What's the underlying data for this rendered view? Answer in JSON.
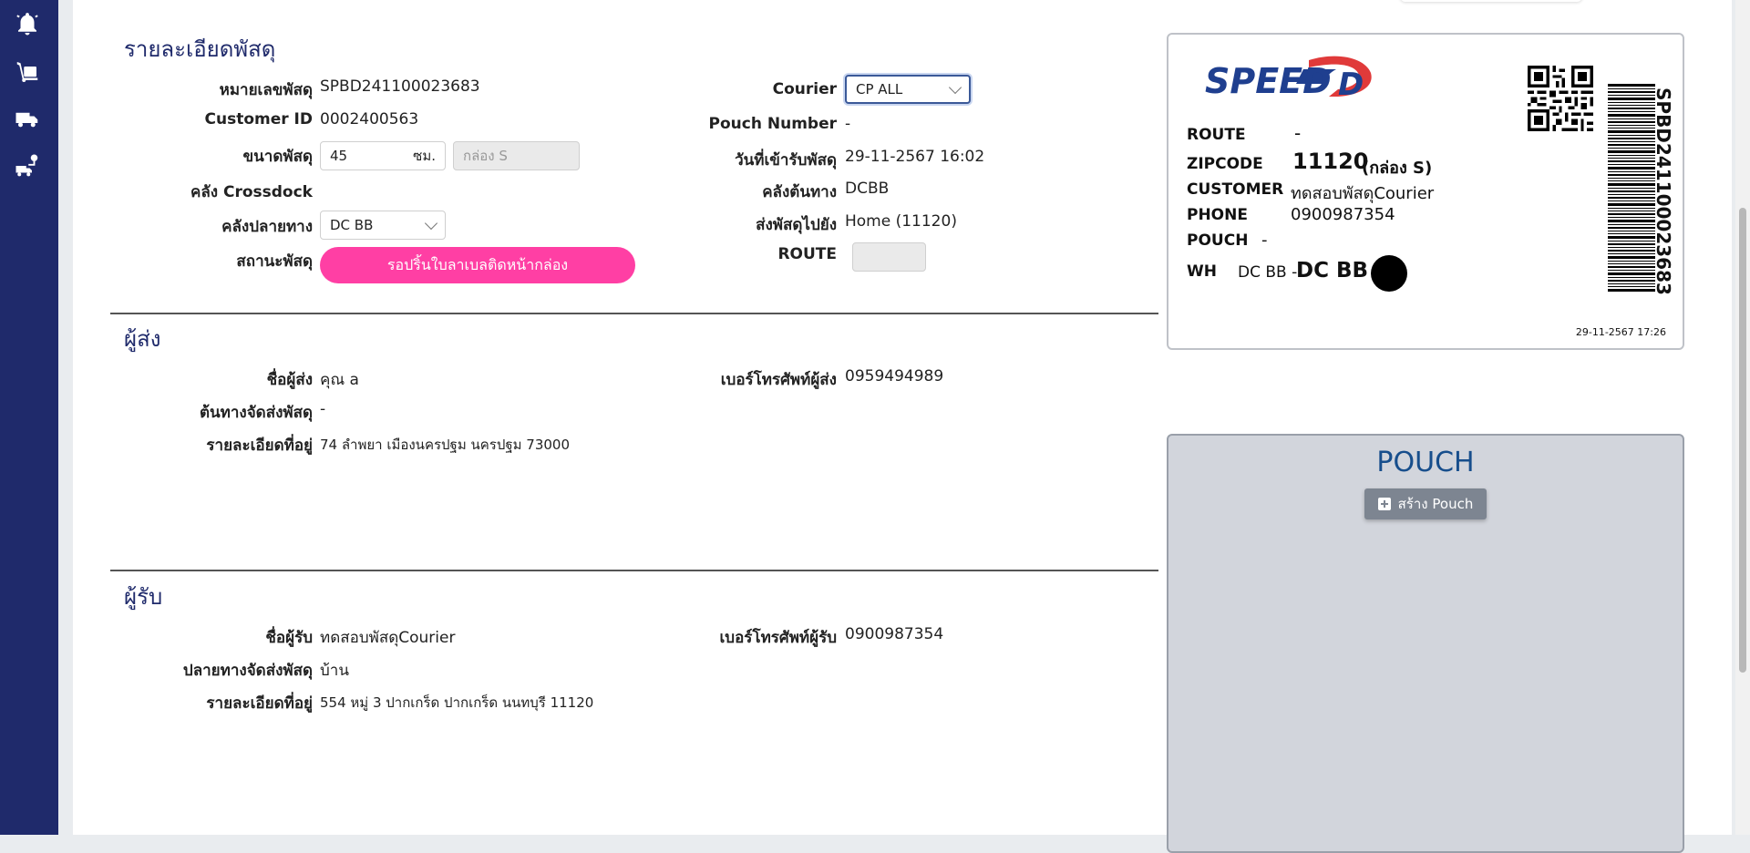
{
  "sidebar": {
    "icons": [
      "bell-icon",
      "box-dolly-icon",
      "truck-icon",
      "route-truck-icon"
    ]
  },
  "parcel": {
    "title": "รายละเอียดพัสดุ",
    "tracking_label": "หมายเลขพัสดุ",
    "tracking_value": "SPBD241100023683",
    "customer_id_label": "Customer ID",
    "customer_id_value": "0002400563",
    "size_label": "ขนาดพัสดุ",
    "size_value": "45",
    "size_unit": "ซม.",
    "box_placeholder": "กล่อง S",
    "crossdock_label": "คลัง Crossdock",
    "dest_wh_label": "คลังปลายทาง",
    "dest_wh_value": "DC BB",
    "status_label": "สถานะพัสดุ",
    "status_value": "รอปริ้นใบลาเบลติดหน้ากล่อง",
    "courier_label": "Courier",
    "courier_value": "CP ALL",
    "pouch_number_label": "Pouch Number",
    "pouch_number_value": "-",
    "received_label": "วันที่เข้ารับพัสดุ",
    "received_value": "29-11-2567 16:02",
    "origin_wh_label": "คลังต้นทาง",
    "origin_wh_value": "DCBB",
    "send_to_label": "ส่งพัสดุไปยัง",
    "send_to_value": "Home (11120)",
    "route_label": "ROUTE",
    "route_value": ""
  },
  "sender": {
    "title": "ผู้ส่ง",
    "name_label": "ชื่อผู้ส่ง",
    "name_value": "คุณ a",
    "origin_label": "ต้นทางจัดส่งพัสดุ",
    "origin_value": "-",
    "address_label": "รายละเอียดที่อยู่",
    "address_value": "74 ลำพยา เมืองนครปฐม นครปฐม 73000",
    "phone_label": "เบอร์โทรศัพท์ผู้ส่ง",
    "phone_value": "0959494989"
  },
  "receiver": {
    "title": "ผู้รับ",
    "name_label": "ชื่อผู้รับ",
    "name_value": "ทดสอบพัสดุCourier",
    "dest_label": "ปลายทางจัดส่งพัสดุ",
    "dest_value": "บ้าน",
    "address_label": "รายละเอียดที่อยู่",
    "address_value": "554 หมู่ 3 ปากเกร็ด ปากเกร็ด นนทบุรี 11120",
    "phone_label": "เบอร์โทรศัพท์ผู้รับ",
    "phone_value": "0900987354"
  },
  "label_card": {
    "logo_text": "SPEED",
    "logo_letter": "D",
    "route_key": "ROUTE",
    "route_val": "-",
    "zipcode_key": "ZIPCODE",
    "zipcode_val": "11120",
    "zipcode_box": "(กล่อง S)",
    "customer_key": "CUSTOMER",
    "customer_val": "ทดสอบพัสดุCourier",
    "phone_key": "PHONE",
    "phone_val": "0900987354",
    "pouch_key": "POUCH",
    "pouch_val": "-",
    "wh_key": "WH",
    "wh_from": "DC BB -",
    "wh_to": "DC BB",
    "barcode_text": "SPBD241100023683",
    "timestamp": "29-11-2567 17:26"
  },
  "pouch_panel": {
    "title": "POUCH",
    "create_button": "สร้าง Pouch"
  },
  "colors": {
    "sidebar": "#1f2a6b",
    "accent_pink": "#ff3fa4",
    "pouch_title": "#174e8c",
    "logo_blue": "#1f3f8f",
    "logo_red": "#e03a3a"
  }
}
